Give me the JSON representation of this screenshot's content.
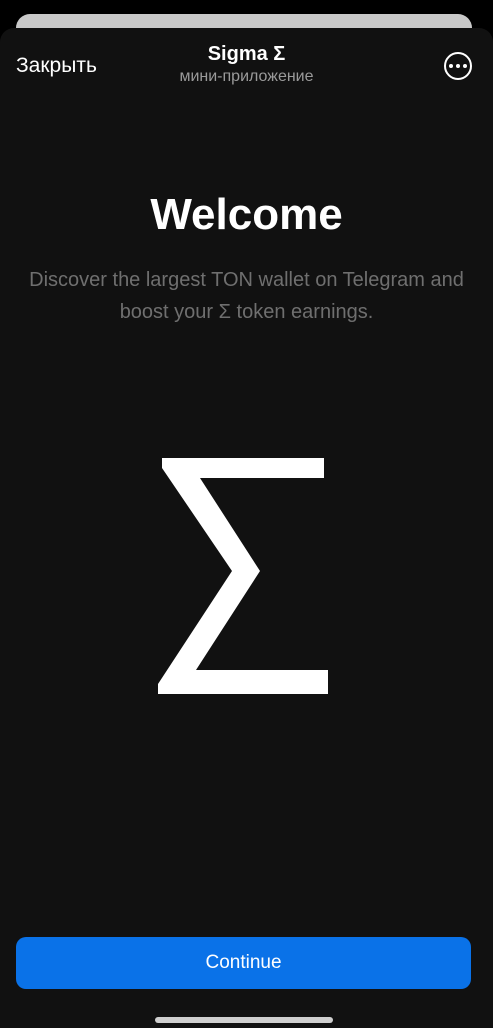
{
  "header": {
    "close_label": "Закрыть",
    "title": "Sigma Σ",
    "subtitle": "мини-приложение",
    "more_icon": "more-horizontal-circle-icon"
  },
  "main": {
    "heading": "Welcome",
    "description": "Discover the largest TON wallet on Telegram and boost your Σ token earnings.",
    "logo_icon": "sigma-icon"
  },
  "footer": {
    "continue_label": "Continue"
  },
  "colors": {
    "background": "#111111",
    "accent": "#0a72e8",
    "text_primary": "#ffffff",
    "text_secondary": "#6f6f6f"
  }
}
